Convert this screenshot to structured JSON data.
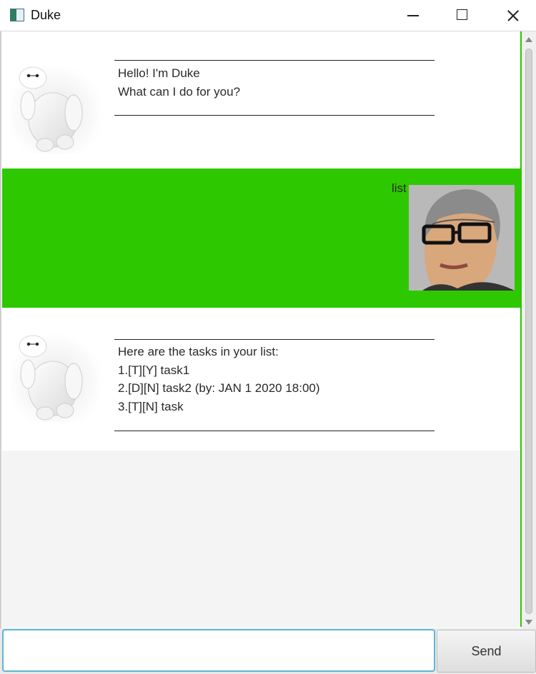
{
  "window": {
    "title": "Duke"
  },
  "dialogs": [
    {
      "lines": "____________________________________________________",
      "text": "Hello! I'm Duke\nWhat can I do for you?"
    },
    {
      "text": "list"
    },
    {
      "lines": "____________________________________________________",
      "text": "Here are the tasks in your list:\n1.[T][Y] task1\n2.[D][N] task2 (by: JAN 1 2020 18:00)\n3.[T][N] task"
    }
  ],
  "input": {
    "placeholder": ""
  },
  "send": {
    "label": "Send"
  },
  "colors": {
    "user_bg": "#2ec800",
    "duke_bg": "#ffffff"
  }
}
